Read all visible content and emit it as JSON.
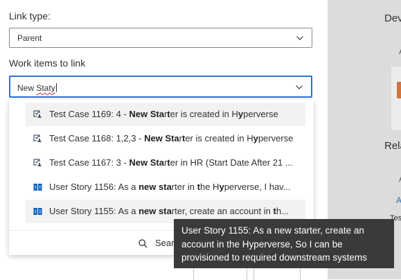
{
  "form": {
    "link_type_label": "Link type:",
    "link_type_value": "Parent",
    "work_items_label": "Work items to link",
    "search_text_plain": "New ",
    "search_text_misspelled": "Staty"
  },
  "dropdown": {
    "items": [
      {
        "icon": "test-case-icon",
        "prefix": "Test Case 1169: 4 - ",
        "b1": "New Sta",
        "m1": "r",
        "b2": "t",
        "suffix": "er is created in H",
        "b3": "y",
        "end": "perverse"
      },
      {
        "icon": "test-case-icon",
        "prefix": "Test Case 1168: 1,2,3 - ",
        "b1": "New Sta",
        "m1": "r",
        "b2": "t",
        "suffix": "er is created in H",
        "b3": "y",
        "end": "perverse"
      },
      {
        "icon": "test-case-icon",
        "prefix": "Test Case 1167: 3 - ",
        "b1": "New Sta",
        "m1": "r",
        "b2": "t",
        "suffix": "er in HR (Start Date After 21 ...",
        "b3": "",
        "end": ""
      },
      {
        "icon": "user-story-icon",
        "prefix": "User Story 1156: As a ",
        "b1": "new sta",
        "m1": "rter in ",
        "b2": "t",
        "suffix": "he H",
        "b3": "y",
        "end": "perverse, I hav..."
      },
      {
        "icon": "user-story-icon",
        "prefix": "User Story 1155: As a ",
        "b1": "new sta",
        "m1": "rter, create an account in ",
        "b2": "t",
        "suffix": "h",
        "b3": "",
        "end": "..."
      }
    ],
    "search_label": "Sear"
  },
  "tooltip": {
    "text": "User Story 1155: As a new starter, create an account in the Hyperverse, So I can be provisioned to required downstream systems"
  },
  "right_panel": {
    "heading1": "Dev",
    "letter_a1": "A",
    "heading2": "Rela",
    "letter_a2": "A",
    "letter_a3": "A",
    "snippet": "Tes"
  },
  "colors": {
    "focus_border": "#2b6fd6",
    "tooltip_bg": "#3b3a39",
    "user_story_icon": "#0a5cb8",
    "test_case_icon": "#4a5568"
  }
}
